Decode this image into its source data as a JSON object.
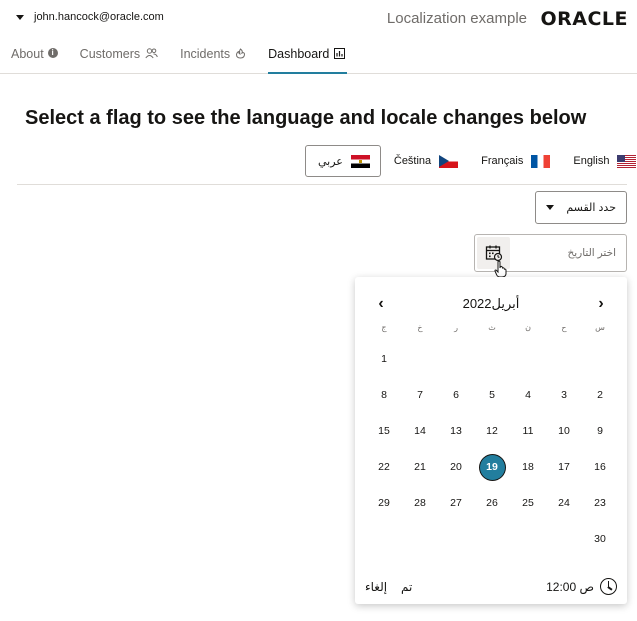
{
  "header": {
    "user": "john.hancock@oracle.com",
    "app_title": "Localization example",
    "logo_text": "ORACLE"
  },
  "tabs": [
    {
      "label": "About",
      "icon": "info-icon",
      "active": false
    },
    {
      "label": "Customers",
      "icon": "people-icon",
      "active": false
    },
    {
      "label": "Incidents",
      "icon": "fire-icon",
      "active": false
    },
    {
      "label": "Dashboard",
      "icon": "chart-icon",
      "active": true
    }
  ],
  "main": {
    "heading": "Select a flag to see the language and locale changes below",
    "flags": [
      {
        "label": "عربي",
        "flag": "egypt-flag-icon",
        "selected": true
      },
      {
        "label": "Čeština",
        "flag": "czech-flag-icon",
        "selected": false
      },
      {
        "label": "Français",
        "flag": "france-flag-icon",
        "selected": false
      },
      {
        "label": "English",
        "flag": "usa-flag-icon",
        "selected": false
      }
    ],
    "section_select": {
      "value": "حدد القسم"
    },
    "date_input": {
      "placeholder": "اختر التاريخ"
    }
  },
  "calendar": {
    "title": "أبريل2022",
    "weekdays": [
      "س",
      "ح",
      "ن",
      "ث",
      "ر",
      "خ",
      "ج"
    ],
    "selected_day": "19",
    "weeks": [
      [
        "",
        "",
        "",
        "",
        "",
        "",
        "1"
      ],
      [
        "2",
        "3",
        "4",
        "5",
        "6",
        "7",
        "8"
      ],
      [
        "9",
        "10",
        "11",
        "12",
        "13",
        "14",
        "15"
      ],
      [
        "16",
        "17",
        "18",
        "19",
        "20",
        "21",
        "22"
      ],
      [
        "23",
        "24",
        "25",
        "26",
        "27",
        "28",
        "29"
      ],
      [
        "30",
        "",
        "",
        "",
        "",
        "",
        ""
      ]
    ],
    "time": "12:00 ص",
    "done_label": "تم",
    "cancel_label": "إلغاء"
  },
  "colors": {
    "accent": "#227e9e",
    "text": "#161513",
    "muted": "#6f6c69"
  }
}
